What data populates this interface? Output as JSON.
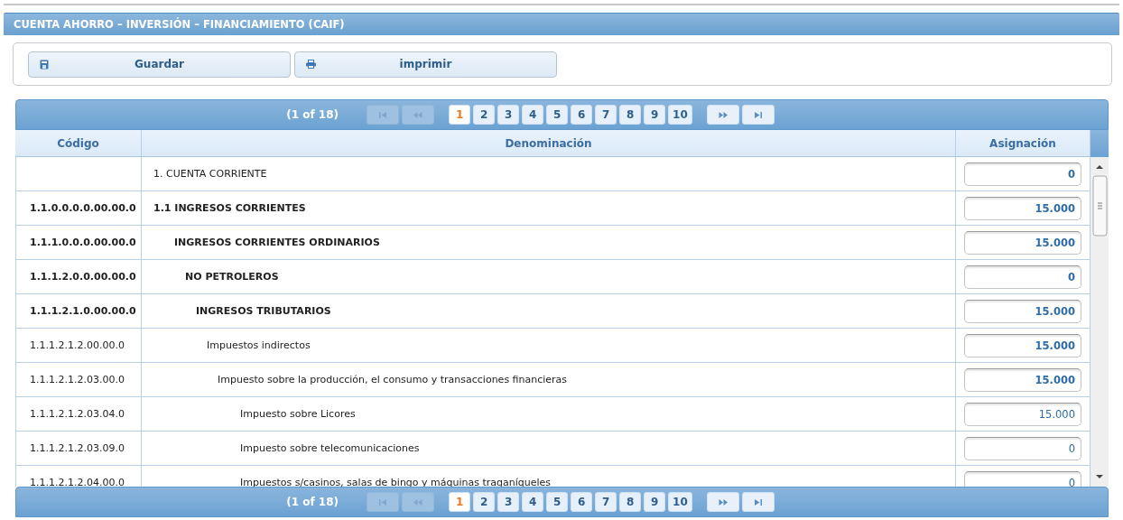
{
  "title": "CUENTA AHORRO – INVERSIÓN – FINANCIAMIENTO (CAIF)",
  "toolbar": [
    {
      "kind": "save",
      "label": "Guardar"
    },
    {
      "kind": "print",
      "label": "imprimir"
    }
  ],
  "pagers": [
    {
      "summary": "(1 of 18)",
      "first_disabled": true,
      "prev_disabled": true,
      "next_disabled": false,
      "last_disabled": false,
      "pages": [
        {
          "label": "1",
          "selected": true
        },
        {
          "label": "2",
          "selected": false
        },
        {
          "label": "3",
          "selected": false
        },
        {
          "label": "4",
          "selected": false
        },
        {
          "label": "5",
          "selected": false
        },
        {
          "label": "6",
          "selected": false
        },
        {
          "label": "7",
          "selected": false
        },
        {
          "label": "8",
          "selected": false
        },
        {
          "label": "9",
          "selected": false
        },
        {
          "label": "10",
          "selected": false
        }
      ]
    },
    {
      "summary": "(1 of 18)",
      "first_disabled": true,
      "prev_disabled": true,
      "next_disabled": false,
      "last_disabled": false,
      "pages": [
        {
          "label": "1",
          "selected": true
        },
        {
          "label": "2",
          "selected": false
        },
        {
          "label": "3",
          "selected": false
        },
        {
          "label": "4",
          "selected": false
        },
        {
          "label": "5",
          "selected": false
        },
        {
          "label": "6",
          "selected": false
        },
        {
          "label": "7",
          "selected": false
        },
        {
          "label": "8",
          "selected": false
        },
        {
          "label": "9",
          "selected": false
        },
        {
          "label": "10",
          "selected": false
        }
      ]
    }
  ],
  "table": {
    "columns": [
      "Código",
      "Denominación",
      "Asignación"
    ],
    "rows": [
      {
        "name": "1. CUENTA CORRIENTE",
        "bold": false,
        "amount": "0",
        "amount_bold": true
      },
      {
        "code": "1.1.0.0.0.0.00.00.0",
        "name": "1.1 INGRESOS CORRIENTES",
        "bold": true,
        "amount": "15.000",
        "amount_bold": true,
        "children": [
          {
            "code": "1.1.1.0.0.0.00.00.0",
            "name": "INGRESOS CORRIENTES ORDINARIOS",
            "bold": true,
            "amount": "15.000",
            "amount_bold": true,
            "children": [
              {
                "code": "1.1.1.2.0.0.00.00.0",
                "name": "NO PETROLEROS",
                "bold": true,
                "amount": "0",
                "amount_bold": true,
                "children": [
                  {
                    "code": "1.1.1.2.1.0.00.00.0",
                    "name": "INGRESOS TRIBUTARIOS",
                    "bold": true,
                    "amount": "15.000",
                    "amount_bold": true,
                    "children": [
                      {
                        "code": "1.1.1.2.1.2.00.00.0",
                        "name": "Impuestos indirectos",
                        "bold": false,
                        "amount": "15.000",
                        "amount_bold": true,
                        "children": [
                          {
                            "code": "1.1.1.2.1.2.03.00.0",
                            "name": "Impuesto sobre la producción, el consumo y transacciones financieras",
                            "bold": false,
                            "amount": "15.000",
                            "amount_bold": true,
                            "children": [
                              {
                                "code": "1.1.1.2.1.2.03.04.0",
                                "name": "Impuesto sobre Licores",
                                "bold": false,
                                "amount": "15.000",
                                "amount_bold": false
                              },
                              {
                                "code": "1.1.1.2.1.2.03.09.0",
                                "name": "Impuesto sobre telecomunicaciones",
                                "bold": false,
                                "amount": "0",
                                "amount_bold": false
                              },
                              {
                                "code": "1.1.1.2.1.2.04.00.0",
                                "name": "Impuestos s/casinos, salas de bingo y máquinas traganíqueles",
                                "bold": false,
                                "amount": "0",
                                "amount_bold": false
                              }
                            ]
                          }
                        ]
                      }
                    ]
                  }
                ]
              }
            ]
          }
        ]
      }
    ]
  }
}
